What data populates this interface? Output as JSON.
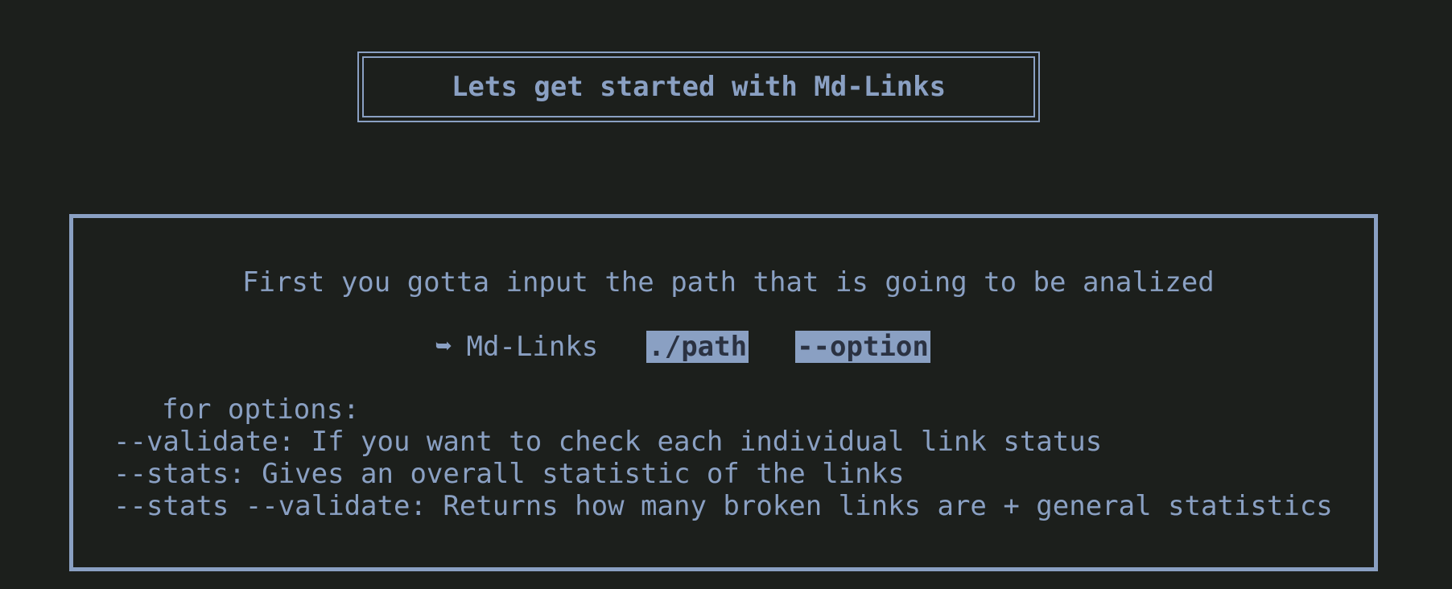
{
  "title": "Lets get started with Md-Links",
  "instructions": {
    "intro": "First you gotta input the path that is going to be analized",
    "command": {
      "arrow": "➥",
      "name": "Md-Links",
      "path_arg": "./path",
      "option_arg": "--option"
    },
    "options_header": "for options:",
    "options": [
      "--validate: If you want to check each individual link status",
      "--stats: Gives an overall statistic of the links",
      "--stats --validate: Returns how many broken links are + general statistics"
    ]
  },
  "colors": {
    "background": "#1c1f1c",
    "accent": "#8aa0c3",
    "highlight_text": "#2b3242"
  }
}
